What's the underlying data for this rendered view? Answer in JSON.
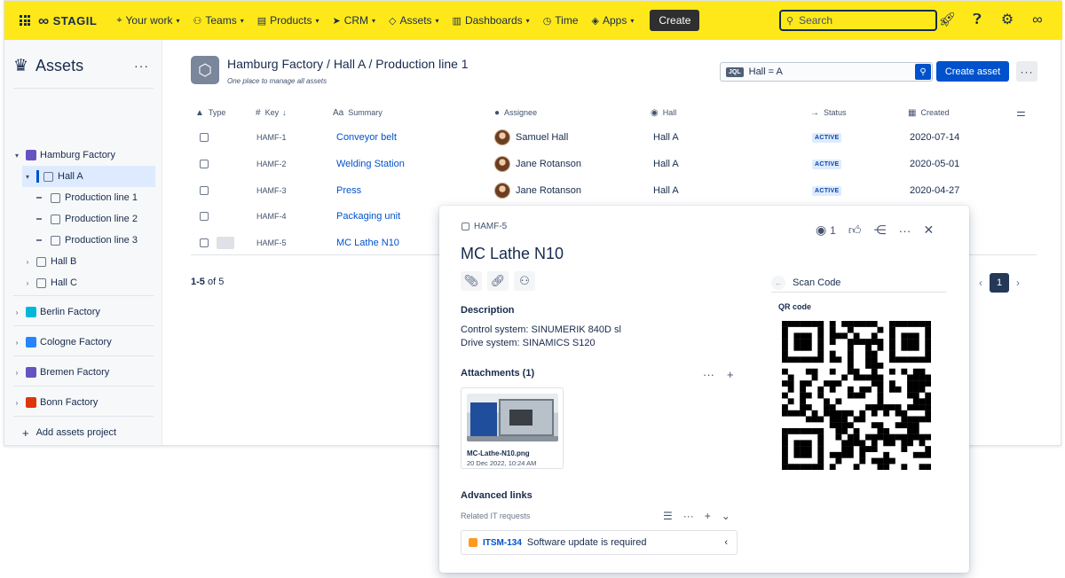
{
  "topbar": {
    "brand": "STAGIL",
    "nav": [
      {
        "label": "Your work",
        "icon": "target-icon"
      },
      {
        "label": "Teams",
        "icon": "people-icon"
      },
      {
        "label": "Products",
        "icon": "box-icon"
      },
      {
        "label": "CRM",
        "icon": "send-icon"
      },
      {
        "label": "Assets",
        "icon": "diamond-icon"
      },
      {
        "label": "Dashboards",
        "icon": "chart-icon"
      },
      {
        "label": "Time",
        "icon": "timer-icon"
      },
      {
        "label": "Apps",
        "icon": "apps-icon"
      }
    ],
    "create_label": "Create",
    "search_placeholder": "Search"
  },
  "sidebar": {
    "title": "Assets",
    "tree": [
      {
        "label": "Hamburg Factory",
        "level": 0
      },
      {
        "label": "Hall A",
        "level": 1,
        "selected": true
      },
      {
        "label": "Production line 1",
        "level": 2
      },
      {
        "label": "Production line 2",
        "level": 2
      },
      {
        "label": "Production line 3",
        "level": 2
      },
      {
        "label": "Hall B",
        "level": 1
      },
      {
        "label": "Hall C",
        "level": 1
      }
    ],
    "factories": [
      {
        "label": "Berlin Factory",
        "color": "#00b8d9"
      },
      {
        "label": "Cologne Factory",
        "color": "#2684ff"
      },
      {
        "label": "Bremen Factory",
        "color": "#6554c0"
      },
      {
        "label": "Bonn Factory",
        "color": "#de350b"
      }
    ],
    "add_project_label": "Add assets project"
  },
  "main": {
    "breadcrumb": "Hamburg  Factory / Hall A / Production line 1",
    "subtitle": "One place to manage all assets",
    "jql_tag": "JQL",
    "jql_query": "Hall = A",
    "create_asset_label": "Create asset",
    "columns": [
      "Type",
      "Key",
      "Summary",
      "Assignee",
      "Hall",
      "Status",
      "Created"
    ],
    "rows": [
      {
        "key": "HAMF-1",
        "summary": "Conveyor belt",
        "assignee": "Samuel Hall",
        "hall": "Hall A",
        "status": "ACTIVE",
        "created": "2020-07-14"
      },
      {
        "key": "HAMF-2",
        "summary": "Welding Station",
        "assignee": "Jane Rotanson",
        "hall": "Hall A",
        "status": "ACTIVE",
        "created": "2020-05-01"
      },
      {
        "key": "HAMF-3",
        "summary": "Press",
        "assignee": "Jane Rotanson",
        "hall": "Hall A",
        "status": "ACTIVE",
        "created": "2020-04-27"
      },
      {
        "key": "HAMF-4",
        "summary": "Packaging unit"
      },
      {
        "key": "HAMF-5",
        "summary": "MC Lathe N10"
      }
    ],
    "count_bold": "1-5",
    "count_rest": " of 5",
    "page": "1"
  },
  "panel": {
    "key": "HAMF-5",
    "title": "MC Lathe N10",
    "watch_count": "1",
    "description_heading": "Description",
    "description_lines": [
      "Control system: SINUMERIK 840D sl",
      "Drive system: SINAMICS S120"
    ],
    "attachments_heading": "Attachments (1)",
    "attachment": {
      "name": "MC-Lathe-N10.png",
      "date": "20 Dec 2022, 10:24 AM"
    },
    "advanced_links_heading": "Advanced links",
    "related_label": "Related IT requests",
    "related_item": {
      "key": "ITSM-134",
      "text": "Software update is required"
    },
    "scan_label": "Scan Code",
    "qr_label": "QR code"
  }
}
